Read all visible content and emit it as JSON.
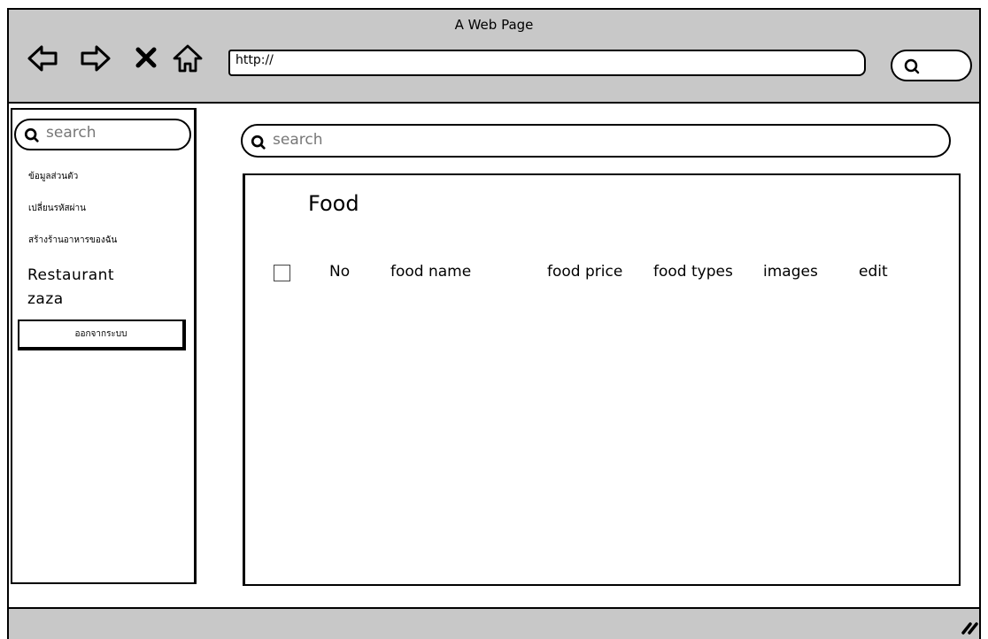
{
  "window": {
    "title": "A Web Page"
  },
  "browser": {
    "url": "http://",
    "icons": [
      "back-arrow-icon",
      "forward-arrow-icon",
      "close-icon",
      "home-icon",
      "search-icon"
    ]
  },
  "sidebar": {
    "search_placeholder": "search",
    "links": [
      "ข้อมูลส่วนตัว",
      "เปลี่ยนรหัสผ่าน",
      "สร้างร้านอาหารของฉัน"
    ],
    "restaurant_label": "Restaurant",
    "restaurant_name": "zaza",
    "logout_label": "ออกจากระบบ"
  },
  "main": {
    "search_placeholder": "search",
    "title": "Food",
    "columns": [
      "No",
      "food name",
      "food price",
      "food types",
      "images",
      "edit"
    ]
  }
}
